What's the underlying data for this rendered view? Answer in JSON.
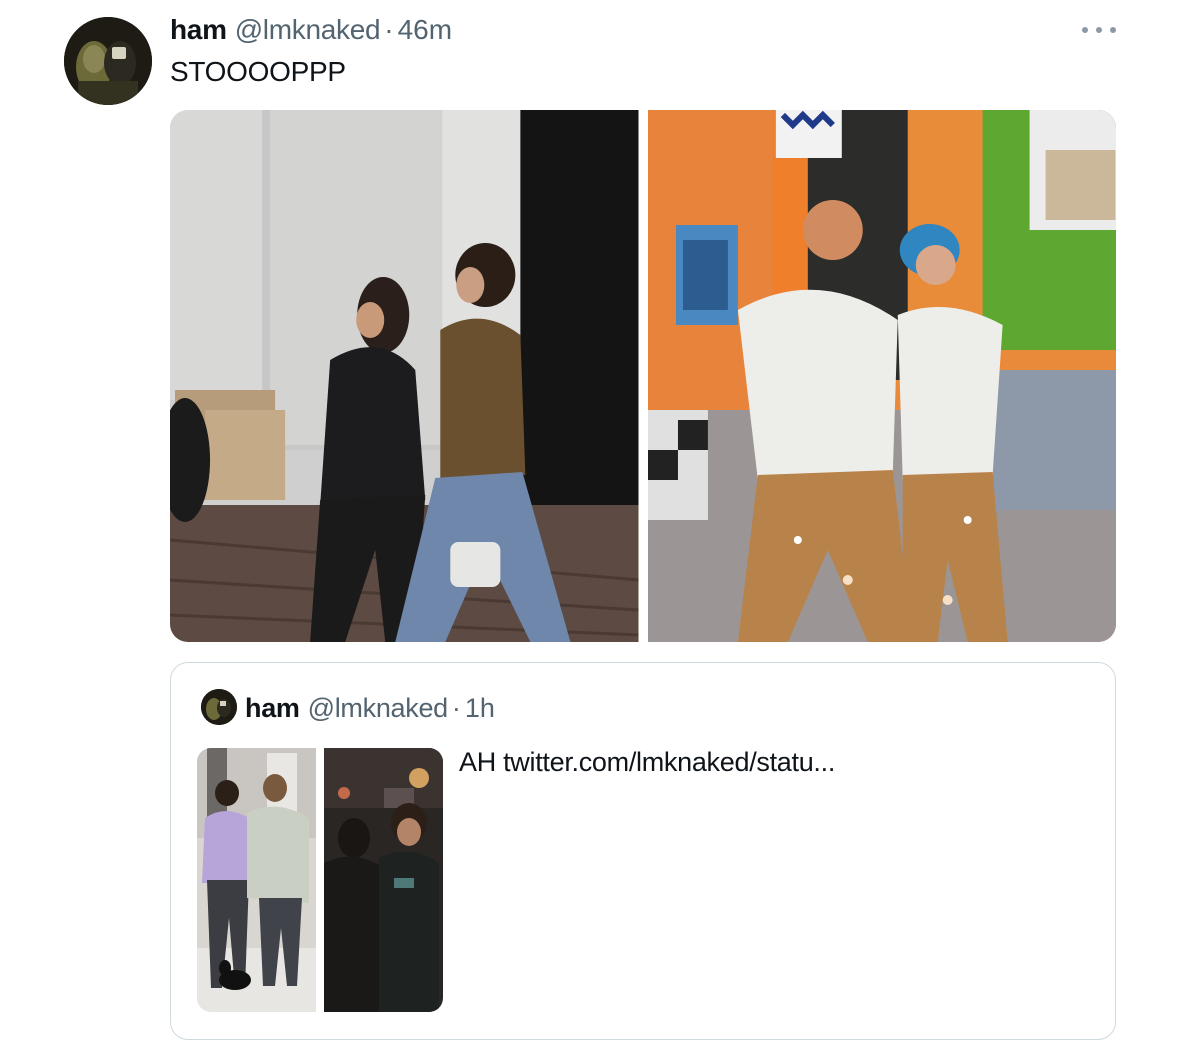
{
  "tweet": {
    "author_name": "ham",
    "author_handle": "@lmknaked",
    "separator": "·",
    "time": "46m",
    "text": "STOOOOPPP",
    "more_icon": "more-horizontal-icon",
    "media": [
      {
        "name": "photo-couple-street"
      },
      {
        "name": "photo-painted-pants-duo"
      }
    ]
  },
  "quoted_tweet": {
    "author_name": "ham",
    "author_handle": "@lmknaked",
    "separator": "·",
    "time": "1h",
    "text": "AH twitter.com/lmknaked/statu...",
    "media": [
      {
        "name": "photo-couple-with-dog"
      },
      {
        "name": "photo-night-street"
      }
    ]
  }
}
